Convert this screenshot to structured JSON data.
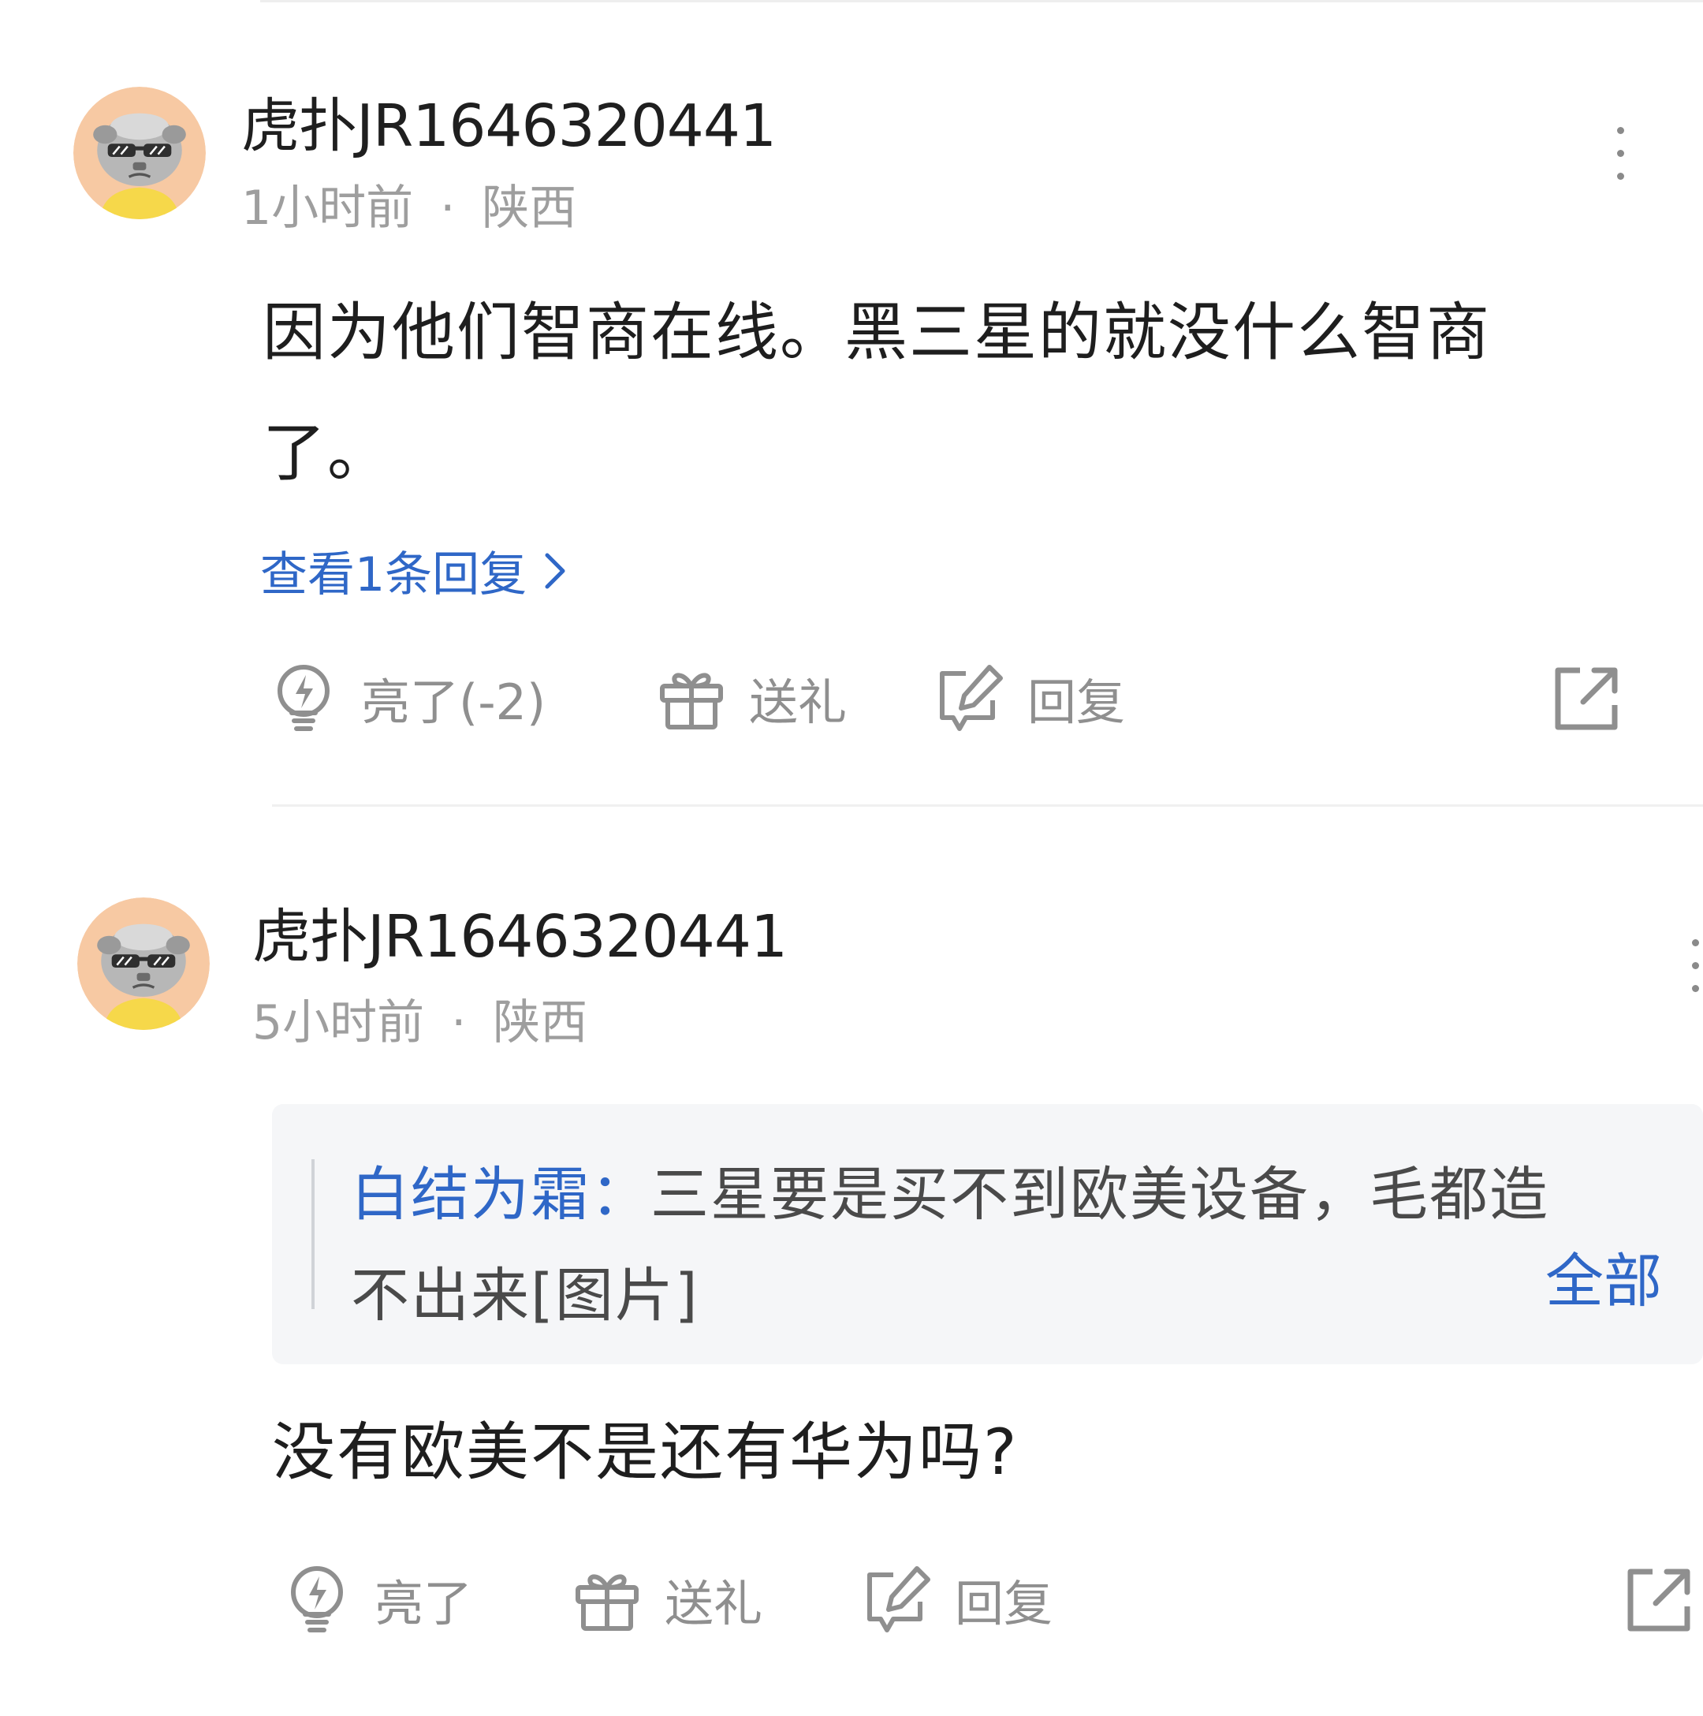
{
  "comments": [
    {
      "username": "虎扑JR1646320441",
      "time": "1小时前",
      "separator": "·",
      "location": "陕西",
      "content_lines": [
        "因为他们智商在线。黑三星的就没什么智商",
        "了。"
      ],
      "view_replies": "查看1条回复",
      "actions": {
        "like": "亮了(-2)",
        "gift": "送礼",
        "reply": "回复"
      }
    },
    {
      "username": "虎扑JR1646320441",
      "time": "5小时前",
      "separator": "·",
      "location": "陕西",
      "quote": {
        "author": "白结为霜",
        "colon": "：",
        "line1": "三星要是买不到欧美设备，毛都造",
        "line2": "不出来[图片]",
        "expand": "全部"
      },
      "content": "没有欧美不是还有华为吗?",
      "actions": {
        "like": "亮了",
        "gift": "送礼",
        "reply": "回复"
      }
    }
  ],
  "colors": {
    "link": "#2f67c7",
    "meta": "#9e9e9e",
    "icon": "#8f8f8f",
    "avatar_bg": "#f7c9a3",
    "avatar_shirt": "#f6d84a"
  },
  "icons": [
    "lightbulb-icon",
    "gift-icon",
    "edit-reply-icon",
    "share-icon",
    "more-vertical-icon",
    "chevron-right-icon"
  ]
}
